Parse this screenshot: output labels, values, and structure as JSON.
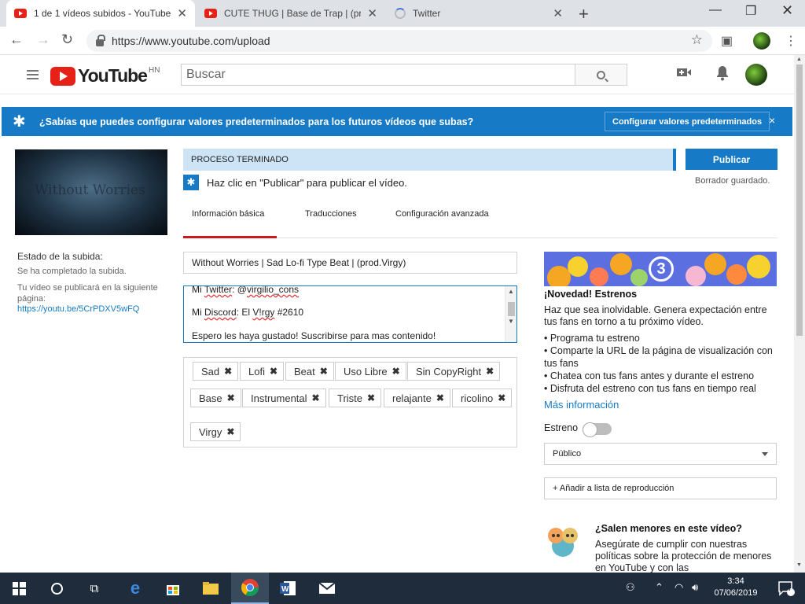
{
  "browser": {
    "tabs": [
      {
        "title": "1 de 1 vídeos subidos - YouTube",
        "active": true
      },
      {
        "title": "CUTE THUG | Base de Trap | (prod",
        "active": false
      },
      {
        "title": "Twitter",
        "active": false
      }
    ],
    "url": "https://www.youtube.com/upload"
  },
  "masthead": {
    "logo": "YouTube",
    "region": "HN",
    "search_placeholder": "Buscar"
  },
  "banner": {
    "text": "¿Sabías que puedes configurar valores predeterminados para los futuros vídeos que subas?",
    "button": "Configurar valores predeterminados",
    "close": "×"
  },
  "sidebar": {
    "thumb_text": "Without Worries",
    "status_title": "Estado de la subida:",
    "status_done": "Se ha completado la subida.",
    "publish_note": "Tu vídeo se publicará en la siguiente página:",
    "link": "https://youtu.be/5CrPDXV5wFQ"
  },
  "upload": {
    "progress": "PROCESO TERMINADO",
    "publish_btn": "Publicar",
    "saved": "Borrador guardado.",
    "hint": "Haz clic en \"Publicar\" para publicar el vídeo.",
    "tabs": [
      "Información básica",
      "Traducciones",
      "Configuración avanzada"
    ],
    "title": "Without Worries | Sad Lo-fi Type Beat | (prod.Virgy)",
    "description": {
      "twitter_label": "Mi ",
      "twitter_word": "Twitter",
      "twitter_rest": ": @",
      "twitter_handle": "virgilio_cons",
      "discord_label": "Mi ",
      "discord_word": "Discord",
      "discord_mid": ": El ",
      "discord_name": "V!rgy",
      "discord_tag": " #2610",
      "closing": "Espero les haya gustado! Suscribirse para mas contenido!"
    },
    "tags": [
      "Sad",
      "Lofi",
      "Beat",
      "Uso Libre",
      "Sin CopyRight",
      "Base",
      "Instrumental",
      "Triste",
      "relajante",
      "ricolino",
      "Virgy"
    ]
  },
  "premiere": {
    "number": "3",
    "title": "¡Novedad! Estrenos",
    "intro": "Haz que sea inolvidable. Genera expectación entre tus fans en torno a tu próximo vídeo.",
    "bullets": [
      "• Programa tu estreno",
      "• Comparte la URL de la página de visualización con tus fans",
      "• Chatea con tus fans antes y durante el estreno",
      "• Disfruta del estreno con tus fans en tiempo real"
    ],
    "more": "Más información",
    "toggle_label": "Estreno",
    "toggle_on": false,
    "privacy": "Público",
    "playlist": "+ Añadir a lista de reproducción"
  },
  "kids": {
    "title": "¿Salen menores en este vídeo?",
    "text": "Asegúrate de cumplir con nuestras políticas sobre la protección de menores en YouTube y con las"
  },
  "taskbar": {
    "time": "3:34",
    "date": "07/06/2019",
    "notifications": "4"
  }
}
